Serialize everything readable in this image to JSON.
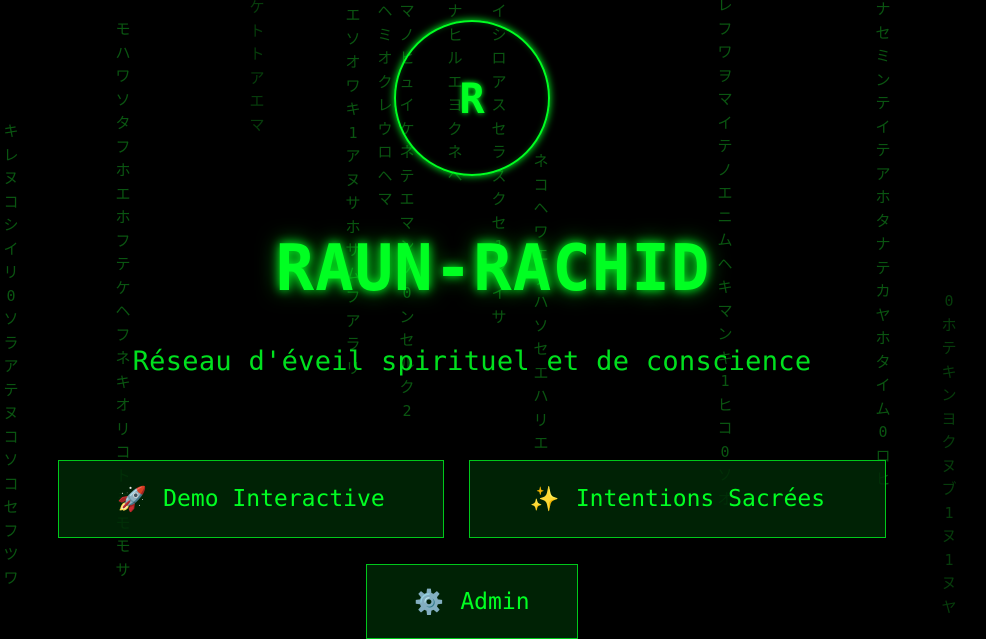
{
  "logo": {
    "letter": "R"
  },
  "title": "RAUN-RACHID",
  "subtitle": "Réseau d'éveil spirituel et de conscience",
  "buttons": {
    "demo": {
      "icon": "rocket-icon",
      "glyph": "🚀",
      "label": "Demo Interactive"
    },
    "intentions": {
      "icon": "sparkles-icon",
      "glyph": "✨",
      "label": "Intentions Sacrées"
    },
    "admin": {
      "icon": "gear-icon",
      "glyph": "⚙️",
      "label": "Admin"
    }
  },
  "colors": {
    "background": "#000000",
    "accent": "#00ff22",
    "rain": "#0b5a12"
  },
  "rain_columns": [
    "キレヌコシイリ0ソラアテヌコソコセフツワ",
    "モハワソタフホエホフテケヘフネキオリコトミモモサ",
    "ケトトアエマ",
    "エソオワキ1アヌサホサムフアラリ",
    "ヘミオクレウロヘマ",
    "マノヒュイケネテエマンノ0ンセルク2",
    "ナヒルエヨクネヘ",
    "イシロアスセラスクセ1アイサ",
    "ネコヘワエチハソセエハリエ",
    "レフワヲマイテノエニムヘキマンキ1ヒコ0ソオ",
    "ナセミンテイテアホタナテカヤホタイム0ロヒ",
    "0ホテキンヨクヌブ1ヌ1ヌヤ"
  ]
}
